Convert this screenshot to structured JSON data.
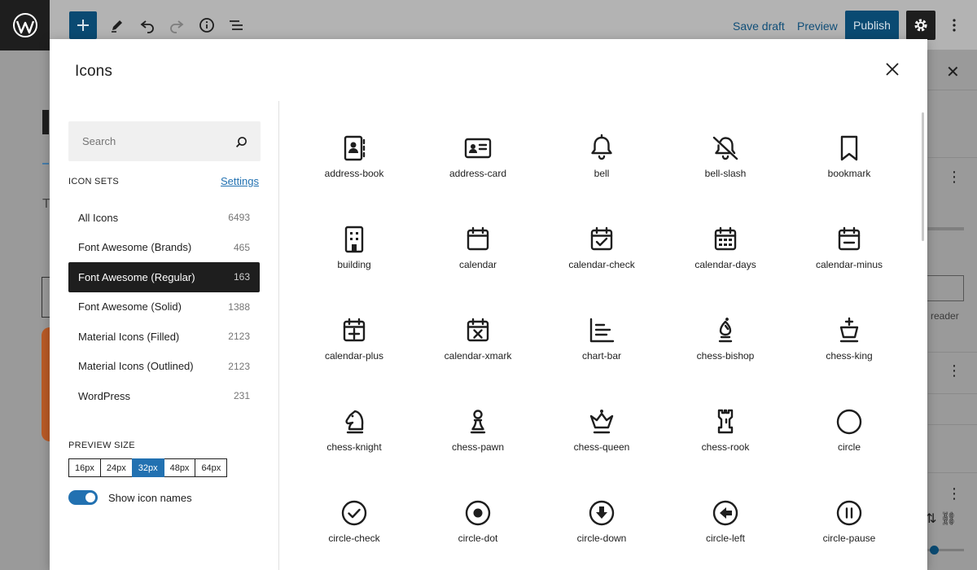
{
  "topbar": {
    "save_draft": "Save draft",
    "preview": "Preview",
    "publish": "Publish"
  },
  "editor": {
    "letter": "T"
  },
  "sidebar": {
    "reader_text": "reader"
  },
  "modal": {
    "title": "Icons",
    "search": {
      "placeholder": "Search",
      "value": ""
    },
    "icon_sets_heading": "ICON SETS",
    "settings_link": "Settings",
    "icon_sets": [
      {
        "label": "All Icons",
        "count": "6493",
        "active": false
      },
      {
        "label": "Font Awesome (Brands)",
        "count": "465",
        "active": false
      },
      {
        "label": "Font Awesome (Regular)",
        "count": "163",
        "active": true
      },
      {
        "label": "Font Awesome (Solid)",
        "count": "1388",
        "active": false
      },
      {
        "label": "Material Icons (Filled)",
        "count": "2123",
        "active": false
      },
      {
        "label": "Material Icons (Outlined)",
        "count": "2123",
        "active": false
      },
      {
        "label": "WordPress",
        "count": "231",
        "active": false
      }
    ],
    "preview_size_heading": "PREVIEW SIZE",
    "sizes": [
      {
        "label": "16px",
        "active": false
      },
      {
        "label": "24px",
        "active": false
      },
      {
        "label": "32px",
        "active": true
      },
      {
        "label": "48px",
        "active": false
      },
      {
        "label": "64px",
        "active": false
      }
    ],
    "show_names_label": "Show icon names",
    "show_names_on": true,
    "icons": [
      {
        "name": "address-book"
      },
      {
        "name": "address-card"
      },
      {
        "name": "bell"
      },
      {
        "name": "bell-slash"
      },
      {
        "name": "bookmark"
      },
      {
        "name": "building"
      },
      {
        "name": "calendar"
      },
      {
        "name": "calendar-check"
      },
      {
        "name": "calendar-days"
      },
      {
        "name": "calendar-minus"
      },
      {
        "name": "calendar-plus"
      },
      {
        "name": "calendar-xmark"
      },
      {
        "name": "chart-bar"
      },
      {
        "name": "chess-bishop"
      },
      {
        "name": "chess-king"
      },
      {
        "name": "chess-knight"
      },
      {
        "name": "chess-pawn"
      },
      {
        "name": "chess-queen"
      },
      {
        "name": "chess-rook"
      },
      {
        "name": "circle"
      },
      {
        "name": "circle-check"
      },
      {
        "name": "circle-dot"
      },
      {
        "name": "circle-down"
      },
      {
        "name": "circle-left"
      },
      {
        "name": "circle-pause"
      }
    ]
  }
}
